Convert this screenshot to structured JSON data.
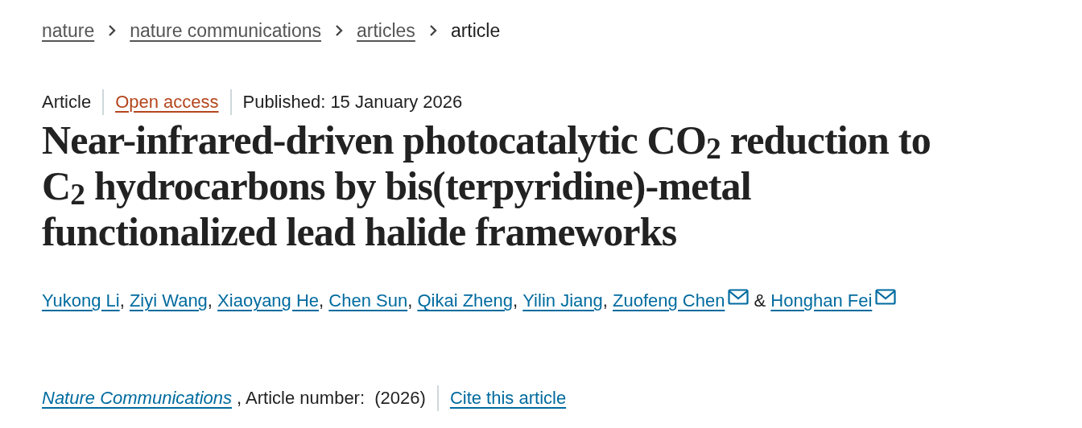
{
  "breadcrumb": [
    {
      "label": "nature",
      "link": true
    },
    {
      "label": "nature communications",
      "link": true
    },
    {
      "label": "articles",
      "link": true
    },
    {
      "label": "article",
      "link": false
    }
  ],
  "meta": {
    "type": "Article",
    "access": "Open access",
    "published": "Published: 15 January 2026"
  },
  "title": "Near-infrared-driven photocatalytic CO$_{2}$ reduction to C$_{2}$ hydrocarbons by bis(terpyridine)-metal functionalized lead halide frameworks",
  "authors": [
    {
      "name": "Yukong Li",
      "email": false,
      "separator": ","
    },
    {
      "name": "Ziyi Wang",
      "email": false,
      "separator": ","
    },
    {
      "name": "Xiaoyang He",
      "email": false,
      "separator": ","
    },
    {
      "name": "Chen Sun",
      "email": false,
      "separator": ","
    },
    {
      "name": "Qikai Zheng",
      "email": false,
      "separator": ","
    },
    {
      "name": "Yilin Jiang",
      "email": false,
      "separator": ","
    },
    {
      "name": "Zuofeng Chen",
      "email": true,
      "separator": "&"
    },
    {
      "name": "Honghan Fei",
      "email": true
    }
  ],
  "citation": {
    "journal": "Nature Communications",
    "details": ", Article number:  (2026)",
    "cite": "Cite this article"
  }
}
